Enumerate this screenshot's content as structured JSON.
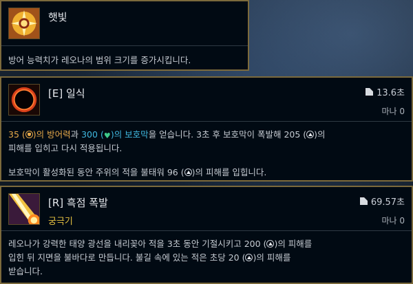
{
  "passive": {
    "name": "햇빛",
    "description": "방어 능력치가 레오나의 범위 크기를 증가시킵니다."
  },
  "ability_e": {
    "name": "[E] 일식",
    "cooldown": "13.6초",
    "cost": "마나 0",
    "line1_a": "35 (",
    "line1_b": ")의 방어력",
    "line1_c": "과 ",
    "line1_d": "300 (",
    "line1_e": ")의 보호막",
    "line1_f": "을 얻습니다. 3초 후 보호막이 폭발해 205 (",
    "line1_g": ")의",
    "line1_h": "피해를 입히고 다시 적용됩니다.",
    "line2_a": "보호막이 활성화된 동안 주위의 적을 불태워 96 (",
    "line2_b": ")의 피해를 입힙니다."
  },
  "ability_r": {
    "name": "[R] 흑점 폭발",
    "ultimate_label": "궁극기",
    "cooldown": "69.57초",
    "cost": "마나 0",
    "line1_a": "레오나가 강력한 태양 광선을 내리꽂아 적을 3초 동안 기절시키고 200 (",
    "line1_b": ")의 피해를",
    "line2_a": "입힌 뒤 지면을 불바다로 만듭니다. 불길 속에 있는 적은 초당 20 (",
    "line2_b": ")의 피해를",
    "line3": "받습니다."
  },
  "colors": {
    "border_gold": "#7c6a3c",
    "armor_orange": "#e8a94a",
    "shield_cyan": "#40b8e0",
    "ultimate_yellow": "#e7c241"
  }
}
